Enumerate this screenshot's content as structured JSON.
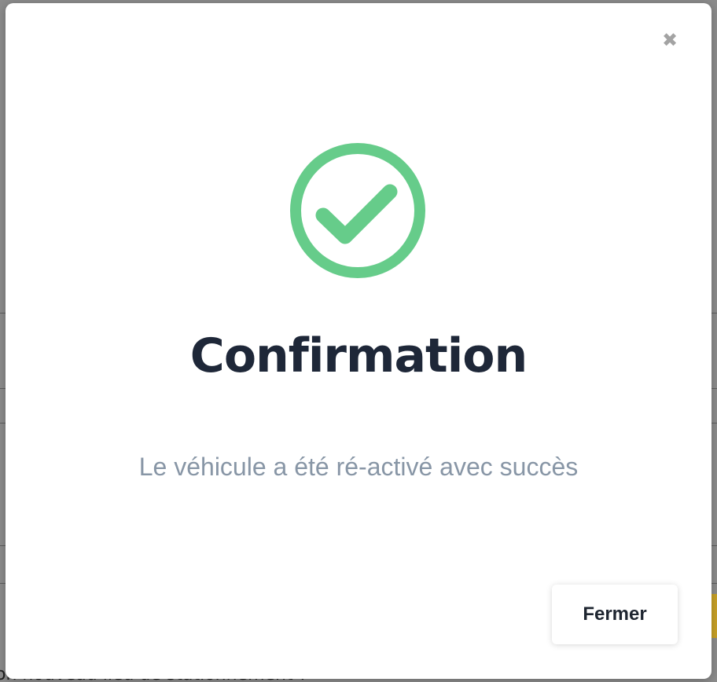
{
  "modal": {
    "close_icon": "close-icon",
    "close_glyph": "✖",
    "status_icon": "check-circle-icon",
    "title": "Confirmation",
    "message": "Le véhicule a été ré-activé avec succès",
    "close_button_label": "Fermer"
  },
  "background": {
    "partial_text": "on nouveau lieu de stationnement ?"
  },
  "colors": {
    "success": "#66cc8a",
    "title": "#1e2738",
    "message": "#8896a6",
    "backdrop": "#8c8c8c"
  }
}
